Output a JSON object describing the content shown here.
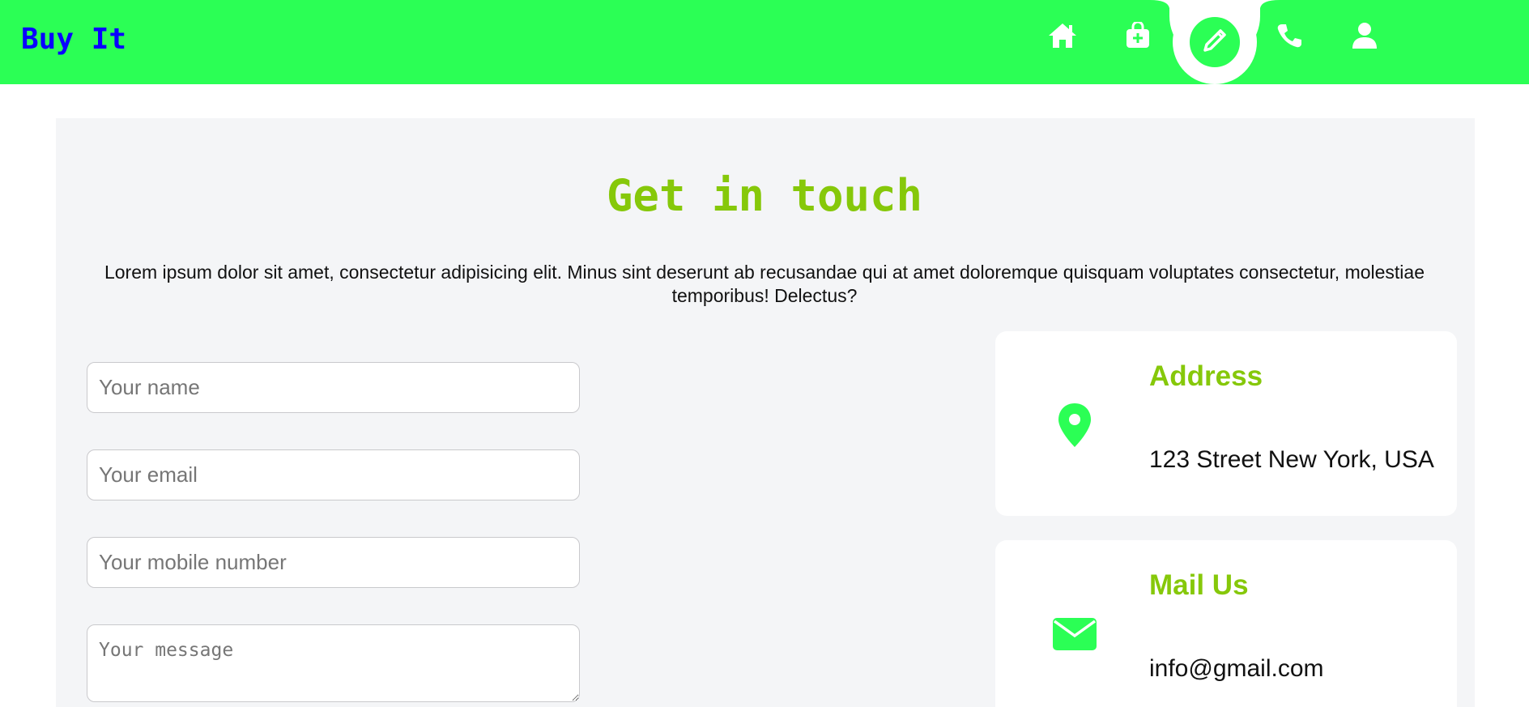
{
  "header": {
    "brand": "Buy It",
    "nav": [
      {
        "icon": "home-icon"
      },
      {
        "icon": "shopping-bag-icon"
      },
      {
        "icon": "pencil-icon",
        "active": true
      },
      {
        "icon": "phone-icon"
      },
      {
        "icon": "user-icon"
      }
    ]
  },
  "contact": {
    "title": "Get in touch",
    "intro": "Lorem ipsum dolor sit amet, consectetur adipisicing elit. Minus sint deserunt ab recusandae qui at amet doloremque quisquam voluptates consectetur, molestiae temporibus! Delectus?",
    "form": {
      "name_placeholder": "Your name",
      "email_placeholder": "Your email",
      "mobile_placeholder": "Your mobile number",
      "message_placeholder": "Your message"
    },
    "cards": [
      {
        "icon": "location-pin-icon",
        "title": "Address",
        "value": "123 Street New York, USA"
      },
      {
        "icon": "envelope-icon",
        "title": "Mail Us",
        "value": "info@gmail.com"
      }
    ]
  },
  "colors": {
    "header_bg": "#2bff55",
    "brand": "#0a00ff",
    "accent": "#86c80a",
    "icon_green": "#2bff55",
    "section_bg": "#f4f5f7"
  }
}
